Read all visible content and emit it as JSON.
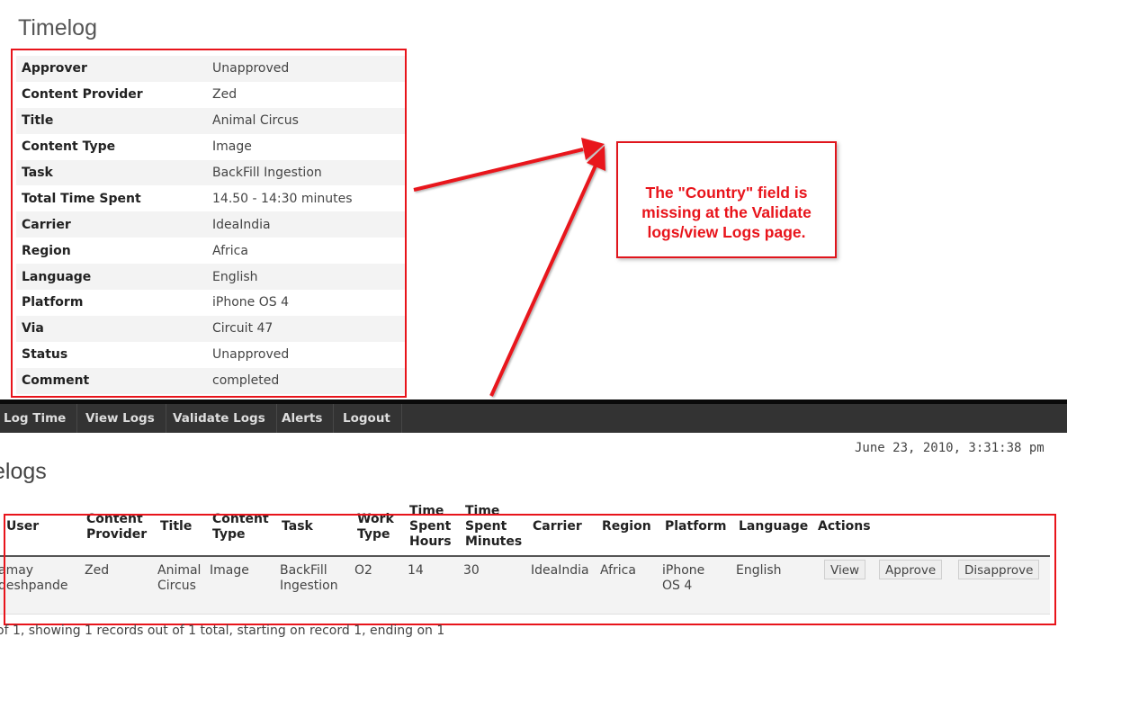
{
  "detail": {
    "title": "Timelog",
    "rows": [
      {
        "label": "Approver",
        "value": "Unapproved"
      },
      {
        "label": "Content Provider",
        "value": "Zed"
      },
      {
        "label": "Title",
        "value": "Animal Circus"
      },
      {
        "label": "Content Type",
        "value": "Image"
      },
      {
        "label": "Task",
        "value": "BackFill Ingestion"
      },
      {
        "label": "Total Time Spent",
        "value": "14.50 - 14:30 minutes"
      },
      {
        "label": "Carrier",
        "value": "IdeaIndia"
      },
      {
        "label": "Region",
        "value": "Africa"
      },
      {
        "label": "Language",
        "value": "English"
      },
      {
        "label": "Platform",
        "value": "iPhone OS 4"
      },
      {
        "label": "Via",
        "value": "Circuit 47"
      },
      {
        "label": "Status",
        "value": "Unapproved"
      },
      {
        "label": "Comment",
        "value": "completed"
      }
    ]
  },
  "annotation": {
    "line1": "The \"Country\" field is",
    "line2": "missing at the Validate",
    "line3": "logs/view Logs page.",
    "color": "#e8141b"
  },
  "nav": {
    "items": [
      "Log Time",
      "View Logs",
      "Validate Logs",
      "Alerts",
      "Logout"
    ]
  },
  "datetime": "June 23, 2010, 3:31:38 pm",
  "page_title": "elogs",
  "table": {
    "headers": {
      "user": "User",
      "content_provider": [
        "Content",
        "Provider"
      ],
      "title": "Title",
      "content_type": [
        "Content",
        "Type"
      ],
      "task": "Task",
      "work_type": [
        "Work",
        "Type"
      ],
      "time_hours": [
        "Time",
        "Spent",
        "Hours"
      ],
      "time_minutes": [
        "Time",
        "Spent",
        "Minutes"
      ],
      "carrier": "Carrier",
      "region": "Region",
      "platform": "Platform",
      "language": "Language",
      "actions": "Actions"
    },
    "row": {
      "user": [
        "amay",
        "deshpande"
      ],
      "content_provider": "Zed",
      "title": [
        "Animal",
        "Circus"
      ],
      "content_type": "Image",
      "task": [
        "BackFill",
        "Ingestion"
      ],
      "work_type": "O2",
      "time_hours": "14",
      "time_minutes": "30",
      "carrier": "IdeaIndia",
      "region": "Africa",
      "platform": [
        "iPhone",
        "OS 4"
      ],
      "language": "English",
      "actions": {
        "view": "View",
        "approve": "Approve",
        "disapprove": "Disapprove"
      }
    },
    "footer": "of 1, showing 1 records out of 1 total, starting on record 1, ending on 1"
  }
}
